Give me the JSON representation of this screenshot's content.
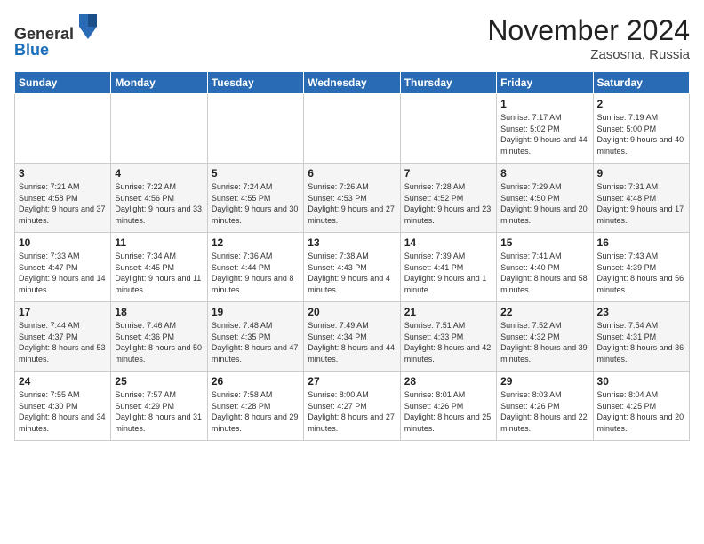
{
  "logo": {
    "line1": "General",
    "line2": "Blue"
  },
  "header": {
    "month": "November 2024",
    "location": "Zasosna, Russia"
  },
  "weekdays": [
    "Sunday",
    "Monday",
    "Tuesday",
    "Wednesday",
    "Thursday",
    "Friday",
    "Saturday"
  ],
  "weeks": [
    [
      {
        "day": "",
        "sunrise": "",
        "sunset": "",
        "daylight": ""
      },
      {
        "day": "",
        "sunrise": "",
        "sunset": "",
        "daylight": ""
      },
      {
        "day": "",
        "sunrise": "",
        "sunset": "",
        "daylight": ""
      },
      {
        "day": "",
        "sunrise": "",
        "sunset": "",
        "daylight": ""
      },
      {
        "day": "",
        "sunrise": "",
        "sunset": "",
        "daylight": ""
      },
      {
        "day": "1",
        "sunrise": "Sunrise: 7:17 AM",
        "sunset": "Sunset: 5:02 PM",
        "daylight": "Daylight: 9 hours and 44 minutes."
      },
      {
        "day": "2",
        "sunrise": "Sunrise: 7:19 AM",
        "sunset": "Sunset: 5:00 PM",
        "daylight": "Daylight: 9 hours and 40 minutes."
      }
    ],
    [
      {
        "day": "3",
        "sunrise": "Sunrise: 7:21 AM",
        "sunset": "Sunset: 4:58 PM",
        "daylight": "Daylight: 9 hours and 37 minutes."
      },
      {
        "day": "4",
        "sunrise": "Sunrise: 7:22 AM",
        "sunset": "Sunset: 4:56 PM",
        "daylight": "Daylight: 9 hours and 33 minutes."
      },
      {
        "day": "5",
        "sunrise": "Sunrise: 7:24 AM",
        "sunset": "Sunset: 4:55 PM",
        "daylight": "Daylight: 9 hours and 30 minutes."
      },
      {
        "day": "6",
        "sunrise": "Sunrise: 7:26 AM",
        "sunset": "Sunset: 4:53 PM",
        "daylight": "Daylight: 9 hours and 27 minutes."
      },
      {
        "day": "7",
        "sunrise": "Sunrise: 7:28 AM",
        "sunset": "Sunset: 4:52 PM",
        "daylight": "Daylight: 9 hours and 23 minutes."
      },
      {
        "day": "8",
        "sunrise": "Sunrise: 7:29 AM",
        "sunset": "Sunset: 4:50 PM",
        "daylight": "Daylight: 9 hours and 20 minutes."
      },
      {
        "day": "9",
        "sunrise": "Sunrise: 7:31 AM",
        "sunset": "Sunset: 4:48 PM",
        "daylight": "Daylight: 9 hours and 17 minutes."
      }
    ],
    [
      {
        "day": "10",
        "sunrise": "Sunrise: 7:33 AM",
        "sunset": "Sunset: 4:47 PM",
        "daylight": "Daylight: 9 hours and 14 minutes."
      },
      {
        "day": "11",
        "sunrise": "Sunrise: 7:34 AM",
        "sunset": "Sunset: 4:45 PM",
        "daylight": "Daylight: 9 hours and 11 minutes."
      },
      {
        "day": "12",
        "sunrise": "Sunrise: 7:36 AM",
        "sunset": "Sunset: 4:44 PM",
        "daylight": "Daylight: 9 hours and 8 minutes."
      },
      {
        "day": "13",
        "sunrise": "Sunrise: 7:38 AM",
        "sunset": "Sunset: 4:43 PM",
        "daylight": "Daylight: 9 hours and 4 minutes."
      },
      {
        "day": "14",
        "sunrise": "Sunrise: 7:39 AM",
        "sunset": "Sunset: 4:41 PM",
        "daylight": "Daylight: 9 hours and 1 minute."
      },
      {
        "day": "15",
        "sunrise": "Sunrise: 7:41 AM",
        "sunset": "Sunset: 4:40 PM",
        "daylight": "Daylight: 8 hours and 58 minutes."
      },
      {
        "day": "16",
        "sunrise": "Sunrise: 7:43 AM",
        "sunset": "Sunset: 4:39 PM",
        "daylight": "Daylight: 8 hours and 56 minutes."
      }
    ],
    [
      {
        "day": "17",
        "sunrise": "Sunrise: 7:44 AM",
        "sunset": "Sunset: 4:37 PM",
        "daylight": "Daylight: 8 hours and 53 minutes."
      },
      {
        "day": "18",
        "sunrise": "Sunrise: 7:46 AM",
        "sunset": "Sunset: 4:36 PM",
        "daylight": "Daylight: 8 hours and 50 minutes."
      },
      {
        "day": "19",
        "sunrise": "Sunrise: 7:48 AM",
        "sunset": "Sunset: 4:35 PM",
        "daylight": "Daylight: 8 hours and 47 minutes."
      },
      {
        "day": "20",
        "sunrise": "Sunrise: 7:49 AM",
        "sunset": "Sunset: 4:34 PM",
        "daylight": "Daylight: 8 hours and 44 minutes."
      },
      {
        "day": "21",
        "sunrise": "Sunrise: 7:51 AM",
        "sunset": "Sunset: 4:33 PM",
        "daylight": "Daylight: 8 hours and 42 minutes."
      },
      {
        "day": "22",
        "sunrise": "Sunrise: 7:52 AM",
        "sunset": "Sunset: 4:32 PM",
        "daylight": "Daylight: 8 hours and 39 minutes."
      },
      {
        "day": "23",
        "sunrise": "Sunrise: 7:54 AM",
        "sunset": "Sunset: 4:31 PM",
        "daylight": "Daylight: 8 hours and 36 minutes."
      }
    ],
    [
      {
        "day": "24",
        "sunrise": "Sunrise: 7:55 AM",
        "sunset": "Sunset: 4:30 PM",
        "daylight": "Daylight: 8 hours and 34 minutes."
      },
      {
        "day": "25",
        "sunrise": "Sunrise: 7:57 AM",
        "sunset": "Sunset: 4:29 PM",
        "daylight": "Daylight: 8 hours and 31 minutes."
      },
      {
        "day": "26",
        "sunrise": "Sunrise: 7:58 AM",
        "sunset": "Sunset: 4:28 PM",
        "daylight": "Daylight: 8 hours and 29 minutes."
      },
      {
        "day": "27",
        "sunrise": "Sunrise: 8:00 AM",
        "sunset": "Sunset: 4:27 PM",
        "daylight": "Daylight: 8 hours and 27 minutes."
      },
      {
        "day": "28",
        "sunrise": "Sunrise: 8:01 AM",
        "sunset": "Sunset: 4:26 PM",
        "daylight": "Daylight: 8 hours and 25 minutes."
      },
      {
        "day": "29",
        "sunrise": "Sunrise: 8:03 AM",
        "sunset": "Sunset: 4:26 PM",
        "daylight": "Daylight: 8 hours and 22 minutes."
      },
      {
        "day": "30",
        "sunrise": "Sunrise: 8:04 AM",
        "sunset": "Sunset: 4:25 PM",
        "daylight": "Daylight: 8 hours and 20 minutes."
      }
    ]
  ]
}
